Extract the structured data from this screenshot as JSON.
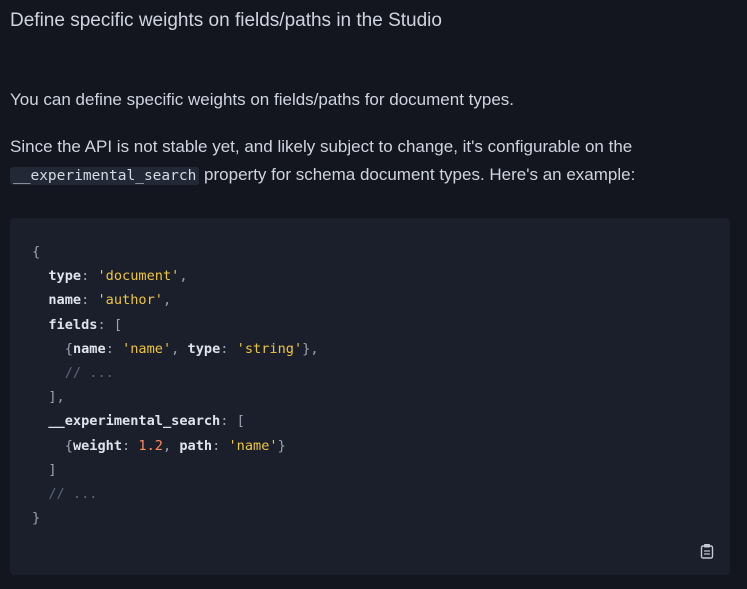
{
  "heading": "Define specific weights on fields/paths in the Studio",
  "paragraph1": "You can define specific weights on fields/paths for document types.",
  "paragraph2": {
    "before_code": "Since the API is not stable yet, and likely subject to change, it's configurable on the ",
    "inline_code": "__experimental_search",
    "after_code": " property for schema document types. Here's an example:"
  },
  "code_block": {
    "lines": [
      [
        {
          "t": "{",
          "c": "p"
        }
      ],
      [
        {
          "t": "  "
        },
        {
          "t": "type",
          "c": "k"
        },
        {
          "t": ": ",
          "c": "p"
        },
        {
          "t": "'document'",
          "c": "s"
        },
        {
          "t": ",",
          "c": "p"
        }
      ],
      [
        {
          "t": "  "
        },
        {
          "t": "name",
          "c": "k"
        },
        {
          "t": ": ",
          "c": "p"
        },
        {
          "t": "'author'",
          "c": "s"
        },
        {
          "t": ",",
          "c": "p"
        }
      ],
      [
        {
          "t": "  "
        },
        {
          "t": "fields",
          "c": "k"
        },
        {
          "t": ": [",
          "c": "p"
        }
      ],
      [
        {
          "t": "    "
        },
        {
          "t": "{",
          "c": "p"
        },
        {
          "t": "name",
          "c": "k"
        },
        {
          "t": ": ",
          "c": "p"
        },
        {
          "t": "'name'",
          "c": "s"
        },
        {
          "t": ", ",
          "c": "p"
        },
        {
          "t": "type",
          "c": "k"
        },
        {
          "t": ": ",
          "c": "p"
        },
        {
          "t": "'string'",
          "c": "s"
        },
        {
          "t": "},",
          "c": "p"
        }
      ],
      [
        {
          "t": "    "
        },
        {
          "t": "// ...",
          "c": "c"
        }
      ],
      [
        {
          "t": "  "
        },
        {
          "t": "],",
          "c": "p"
        }
      ],
      [
        {
          "t": "  "
        },
        {
          "t": "__experimental_search",
          "c": "k"
        },
        {
          "t": ": [",
          "c": "p"
        }
      ],
      [
        {
          "t": "    "
        },
        {
          "t": "{",
          "c": "p"
        },
        {
          "t": "weight",
          "c": "k"
        },
        {
          "t": ": ",
          "c": "p"
        },
        {
          "t": "1.2",
          "c": "n"
        },
        {
          "t": ", ",
          "c": "p"
        },
        {
          "t": "path",
          "c": "k"
        },
        {
          "t": ": ",
          "c": "p"
        },
        {
          "t": "'name'",
          "c": "s"
        },
        {
          "t": "}",
          "c": "p"
        }
      ],
      [
        {
          "t": "  "
        },
        {
          "t": "]",
          "c": "p"
        }
      ],
      [
        {
          "t": "  "
        },
        {
          "t": "// ...",
          "c": "c"
        }
      ],
      [
        {
          "t": "}",
          "c": "p"
        }
      ]
    ]
  },
  "icons": {
    "copy": "clipboard-icon"
  },
  "colors": {
    "background": "#13161f",
    "code_background": "#1b1f2b",
    "string": "#eec63b",
    "number": "#ff8a5b"
  }
}
